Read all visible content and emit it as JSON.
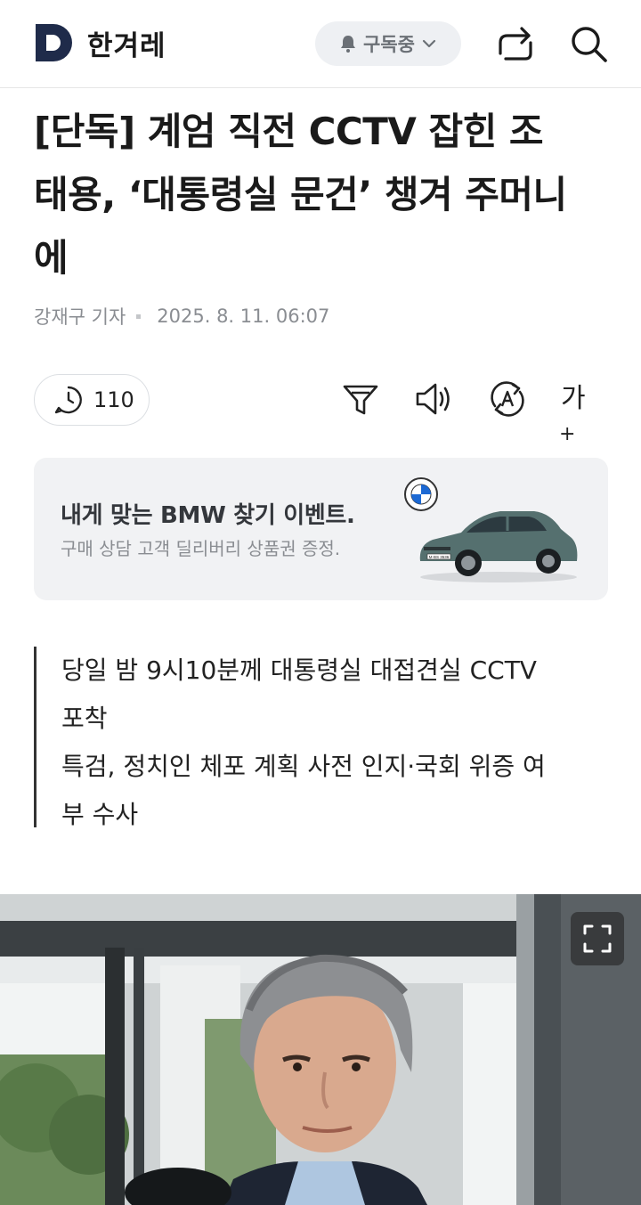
{
  "header": {
    "logo_text": "한겨레",
    "subscribe_label": "구독중",
    "icons": [
      "d-logo-icon",
      "bell-icon",
      "chevron-down-icon",
      "share-icon",
      "search-icon"
    ]
  },
  "article": {
    "headline_lines": [
      "[단독] 계엄 직전 CCTV 잡힌 조",
      "태용, ‘대통령실 문건’ 챙겨 주머니",
      "에"
    ],
    "author": "강재구 기자",
    "date": "2025. 8. 11. 06:07"
  },
  "toolbar": {
    "comment_count": "110",
    "font_label": "가",
    "font_plus": "+",
    "icons": [
      "comment-icon",
      "filter-icon",
      "speaker-icon",
      "translate-icon"
    ]
  },
  "ad": {
    "title": "내게 맞는 BMW 찾기 이벤트.",
    "subtitle": "구매 상담 고객 딜리버리 상품권 증정.",
    "plate": "M·BS 3536"
  },
  "summary": {
    "lines": [
      "당일 밤 9시10분께 대통령실 대접견실 CCTV",
      "포착",
      "특검, 정치인 체포 계획 사전 인지·국회 위증 여",
      "부 수사"
    ]
  },
  "colors": {
    "logo_navy": "#1f2b4a",
    "pill_bg": "#eef0f3",
    "ad_bg": "#f1f2f4",
    "text_primary": "#1a1a1a",
    "text_muted": "#8a8d92"
  }
}
